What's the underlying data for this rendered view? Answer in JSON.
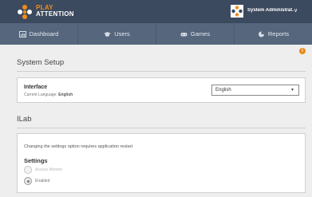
{
  "header": {
    "brand_line1": "PLAY",
    "brand_line2": "ATTENTION",
    "user_name": "System Administrat...",
    "user_caret": "∨"
  },
  "nav": [
    {
      "label": "Dashboard",
      "icon": "dashboard-icon"
    },
    {
      "label": "Users",
      "icon": "graduation-cap-icon"
    },
    {
      "label": "Games",
      "icon": "gamepad-icon"
    },
    {
      "label": "Reports",
      "icon": "chart-icon"
    }
  ],
  "info_badge": "i",
  "system_setup": {
    "title": "System Setup",
    "interface_title": "Interface",
    "current_language_label": "Current Language:",
    "current_language_value": "English",
    "language_select_value": "English"
  },
  "ilab": {
    "title": "ILab",
    "restart_note": "Changing the settings option requires application restart",
    "settings_title": "Settings",
    "options": [
      {
        "label": "Access Monitor",
        "state": "disabled"
      },
      {
        "label": "Enabled",
        "state": "selected"
      }
    ]
  },
  "colors": {
    "brand_orange": "#f28c1e",
    "header_bg": "#3b4a5e",
    "nav_bg": "#55667d"
  }
}
